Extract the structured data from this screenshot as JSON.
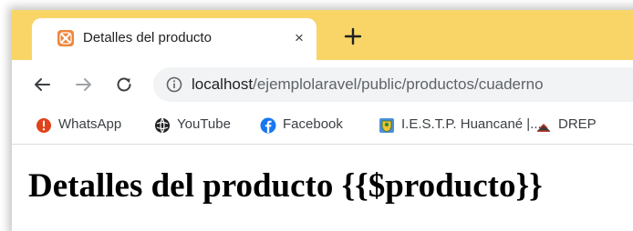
{
  "tab": {
    "title": "Detalles del producto",
    "close_glyph": "×"
  },
  "address_bar": {
    "url_host": "localhost",
    "url_path": "/ejemplolaravel/public/productos/cuaderno"
  },
  "bookmarks": [
    {
      "label": "WhatsApp",
      "icon": "whatsapp-icon"
    },
    {
      "label": "YouTube",
      "icon": "youtube-icon"
    },
    {
      "label": "Facebook",
      "icon": "facebook-icon"
    },
    {
      "label": "I.E.S.T.P. Huancané |...",
      "icon": "institute-icon"
    },
    {
      "label": "DREP",
      "icon": "drep-icon"
    }
  ],
  "page": {
    "heading": "Detalles del producto {{$producto}}"
  },
  "colors": {
    "tabstrip": "#f8d566",
    "favicon": "#f0853a",
    "whatsapp": "#e0421a",
    "facebook": "#1877f2"
  }
}
